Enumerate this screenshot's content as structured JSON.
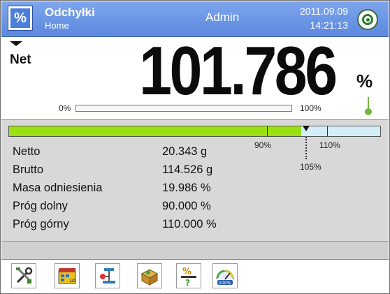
{
  "header": {
    "mode_icon_glyph": "%",
    "title": "Odchyłki",
    "subtitle": "Home",
    "user": "Admin",
    "date": "2011.09.09",
    "time": "14:21:13",
    "accent_color": "#5c88dd"
  },
  "weight_panel": {
    "net_label": "Net",
    "value": "101.786",
    "unit": "%",
    "bar_min_label": "0%",
    "bar_max_label": "100%",
    "bar_fill_fraction": 0.0
  },
  "target_bar": {
    "fill_fraction": 0.82,
    "lower_limit_label": "90%",
    "upper_limit_label": "110%",
    "reference_label": "105%",
    "fill_color": "#9be012",
    "zone_color": "#d4eef8"
  },
  "info_rows": [
    {
      "label": "Netto",
      "value": "20.343 g"
    },
    {
      "label": "Brutto",
      "value": "114.526 g"
    },
    {
      "label": "Masa odniesienia",
      "value": "19.986 %"
    },
    {
      "label": "Próg dolny",
      "value": "90.000 %"
    },
    {
      "label": "Próg górny",
      "value": "110.000 %"
    }
  ],
  "toolbar": {
    "icons": [
      "tools-icon",
      "thresholds-icon",
      "tare-icon",
      "product-database-icon",
      "reference-mass-icon",
      "percent-mode-icon"
    ]
  }
}
